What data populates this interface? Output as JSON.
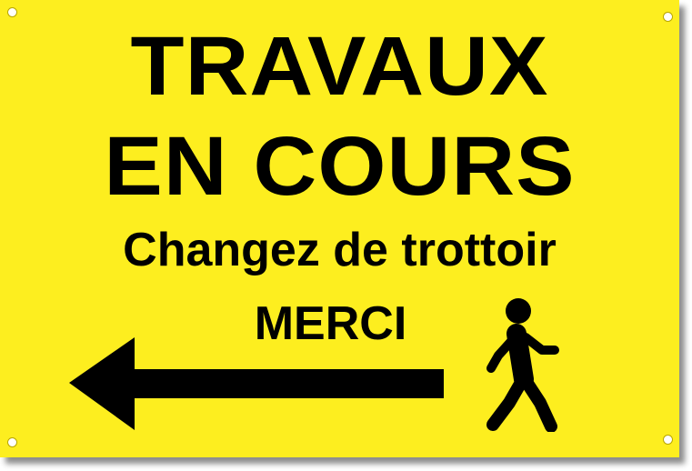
{
  "sign": {
    "line1": "TRAVAUX",
    "line2": "EN COURS",
    "line3": "Changez de trottoir",
    "line4": "MERCI",
    "background_color": "#fdee1f",
    "text_color": "#000000",
    "arrow_direction": "left",
    "pictogram": "pedestrian-icon"
  }
}
